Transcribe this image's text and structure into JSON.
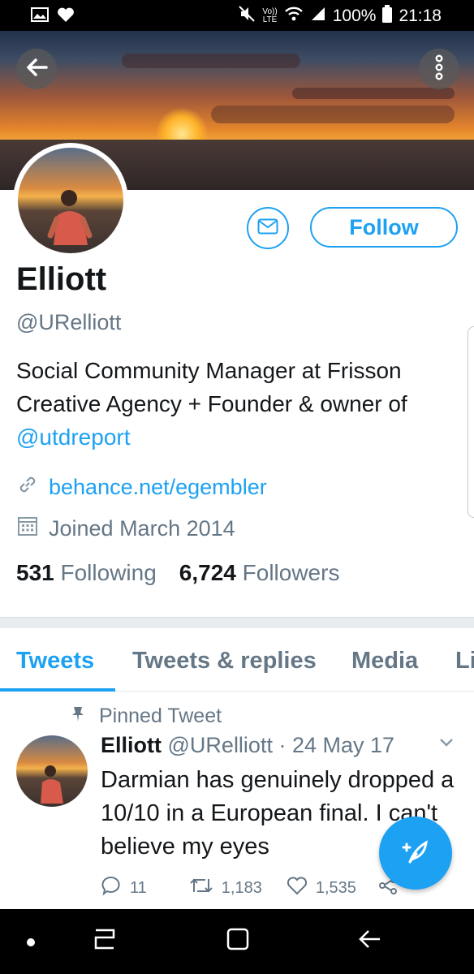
{
  "status_bar": {
    "volte": "Vo))",
    "lte": "LTE",
    "battery": "100%",
    "time": "21:18",
    "icons": [
      "image-icon",
      "heart-icon",
      "mute-icon",
      "wifi-icon",
      "signal-icon",
      "battery-icon"
    ]
  },
  "header": {
    "back_icon": "arrow-left-icon",
    "more_icon": "more-vertical-icon"
  },
  "profile": {
    "follow_label": "Follow",
    "name": "Elliott",
    "handle": "@URelliott",
    "bio_text": "Social Community Manager at Frisson Creative Agency + Founder & owner of ",
    "bio_mention": "@utdreport",
    "website": "behance.net/egembler",
    "joined": "Joined March 2014",
    "following_count": "531",
    "following_label": "Following",
    "followers_count": "6,724",
    "followers_label": "Followers"
  },
  "tabs": [
    {
      "label": "Tweets",
      "active": true
    },
    {
      "label": "Tweets & replies",
      "active": false
    },
    {
      "label": "Media",
      "active": false
    },
    {
      "label": "Li",
      "active": false
    }
  ],
  "tweet": {
    "pinned_label": "Pinned Tweet",
    "author_name": "Elliott",
    "author_handle": "@URelliott",
    "separator": "·",
    "date": "24 May 17",
    "text": "Darmian has genuinely dropped a 10/10 in a European final. I can't believe my eyes",
    "replies": "11",
    "retweets": "1,183",
    "likes": "1,535"
  },
  "colors": {
    "accent": "#1da1f2",
    "secondary_text": "#657786",
    "primary_text": "#14171a"
  }
}
